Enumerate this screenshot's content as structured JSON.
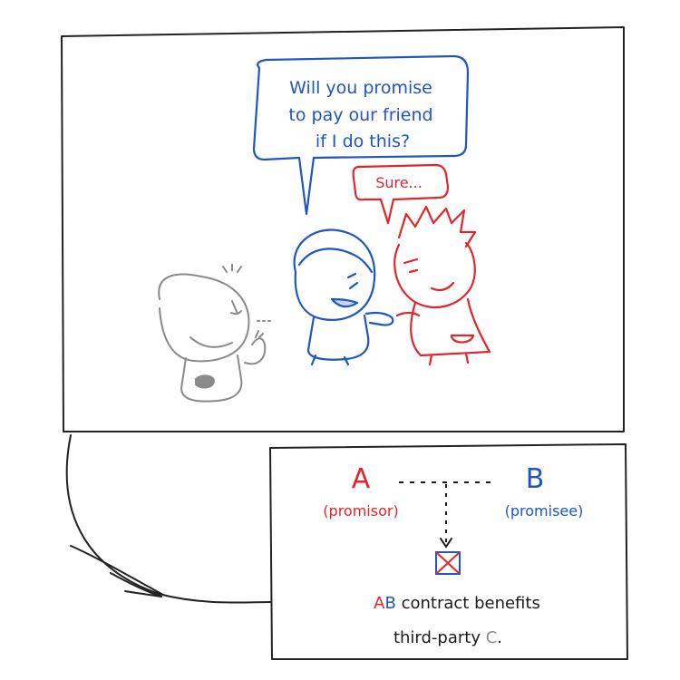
{
  "colors": {
    "blue": "#1f55c4",
    "red": "#e0262b",
    "gray": "#8a8a8a",
    "ink": "#1a1a1a"
  },
  "speech": {
    "blue_line1": "Will you promise",
    "blue_line2": "to pay our friend",
    "blue_line3": "if I do this?",
    "red": "Sure..."
  },
  "diagram": {
    "party_a": "A",
    "party_a_role": "(promisor)",
    "party_b": "B",
    "party_b_role": "(promisee)",
    "caption_a": "A",
    "caption_b": "B",
    "caption_mid": " contract benefits",
    "caption_line2": "third-party ",
    "caption_c": "C",
    "caption_end": "."
  },
  "icons": {
    "beneficiary": "crossed-box-icon"
  }
}
